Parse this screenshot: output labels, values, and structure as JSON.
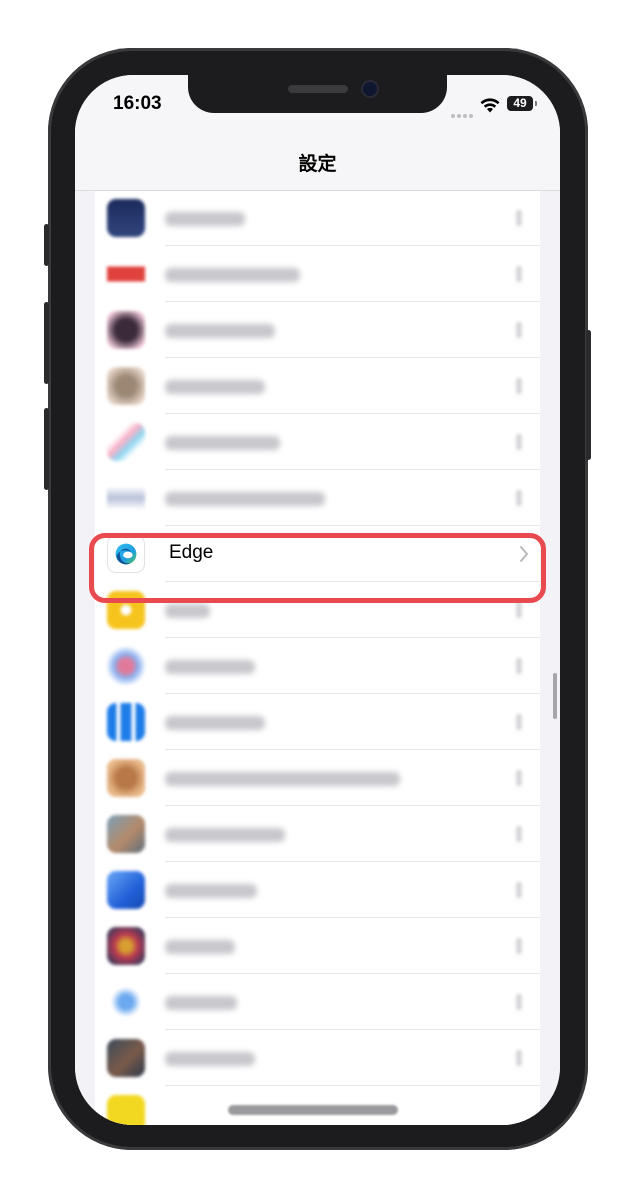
{
  "status_bar": {
    "time": "16:03",
    "battery": "49"
  },
  "nav": {
    "title": "設定"
  },
  "edge_row": {
    "label": "Edge"
  },
  "colors": {
    "highlight": "#e84a4f",
    "list_background": "#f2f2f7"
  },
  "icons": {
    "edge": "edge-app-icon",
    "chevron": "chevron-right-icon",
    "wifi": "wifi-icon",
    "battery": "battery-icon"
  }
}
